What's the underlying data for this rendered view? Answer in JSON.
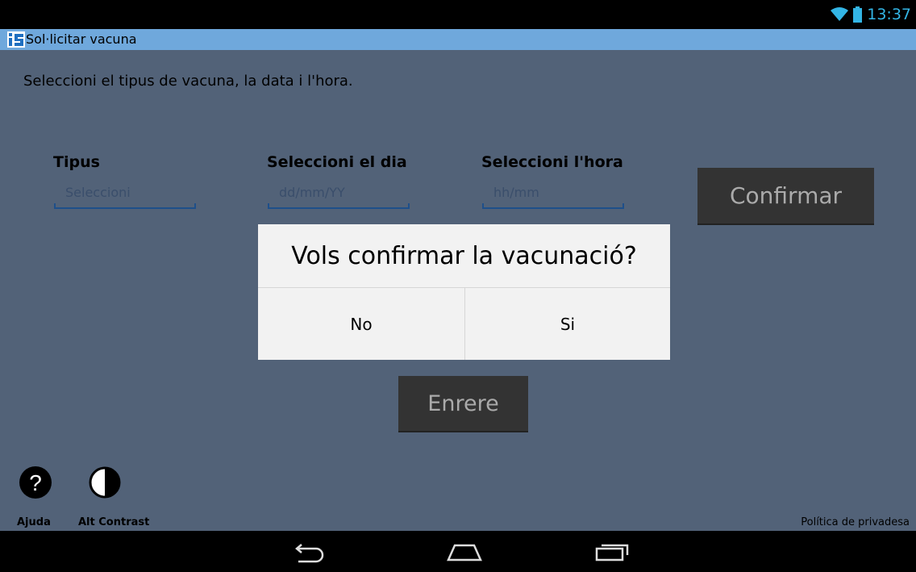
{
  "status_bar": {
    "time": "13:37",
    "wifi_icon": "wifi-icon",
    "battery_icon": "battery-icon"
  },
  "title_bar": {
    "title": "Sol·licitar vacuna",
    "logo_icon": "app-logo-icon"
  },
  "main": {
    "instruction": "Seleccioni el tipus de vacuna, la data i l'hora.",
    "fields": [
      {
        "label": "Tipus",
        "placeholder": "Seleccioni"
      },
      {
        "label": "Seleccioni el dia",
        "placeholder": "dd/mm/YY"
      },
      {
        "label": "Seleccioni l'hora",
        "placeholder": "hh/mm"
      }
    ],
    "confirm_button": "Confirmar",
    "back_button": "Enrere"
  },
  "dialog": {
    "question": "Vols confirmar la vacunació?",
    "no_label": "No",
    "yes_label": "Si"
  },
  "footer": {
    "help_label": "Ajuda",
    "contrast_label": "Alt Contrast",
    "privacy_label": "Política de privadesa"
  },
  "nav": {
    "back_icon": "back-icon",
    "home_icon": "home-icon",
    "recents_icon": "recents-icon"
  },
  "colors": {
    "title_bar": "#6fa8dc",
    "background": "#526278",
    "accent": "#33b5e5",
    "dialog": "#f2f2f2",
    "button": "#333333"
  }
}
